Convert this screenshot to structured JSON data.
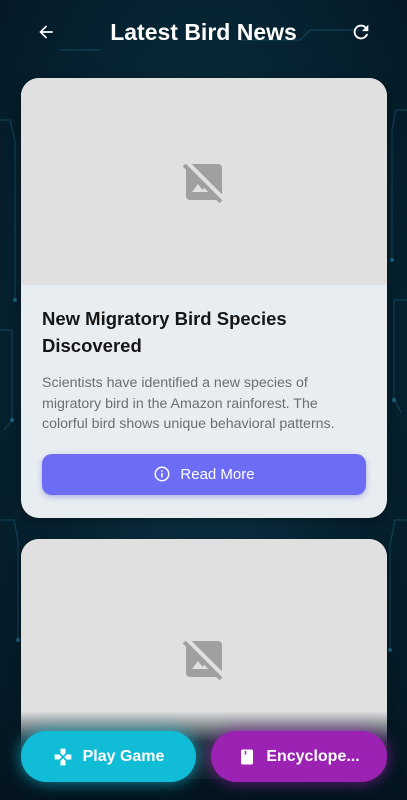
{
  "header": {
    "title": "Latest Bird News",
    "back_icon": "arrow-left-icon",
    "refresh_icon": "refresh-icon"
  },
  "news": [
    {
      "title": "New Migratory Bird Species Discovered",
      "description": "Scientists have identified a new species of migratory bird in the Amazon rainforest. The colorful bird shows unique behavioral patterns.",
      "button_label": "Read More",
      "image_icon": "image-unavailable-icon"
    },
    {
      "image_icon": "image-unavailable-icon"
    }
  ],
  "bottom_nav": {
    "game_label": "Play Game",
    "game_icon": "gamepad-icon",
    "encyclopedia_label": "Encyclope...",
    "encyclopedia_icon": "book-icon"
  },
  "colors": {
    "background": "#072433",
    "read_more": "#6c6cf4",
    "play_game": "#11bcd6",
    "encyclopedia": "#9b22b3"
  }
}
